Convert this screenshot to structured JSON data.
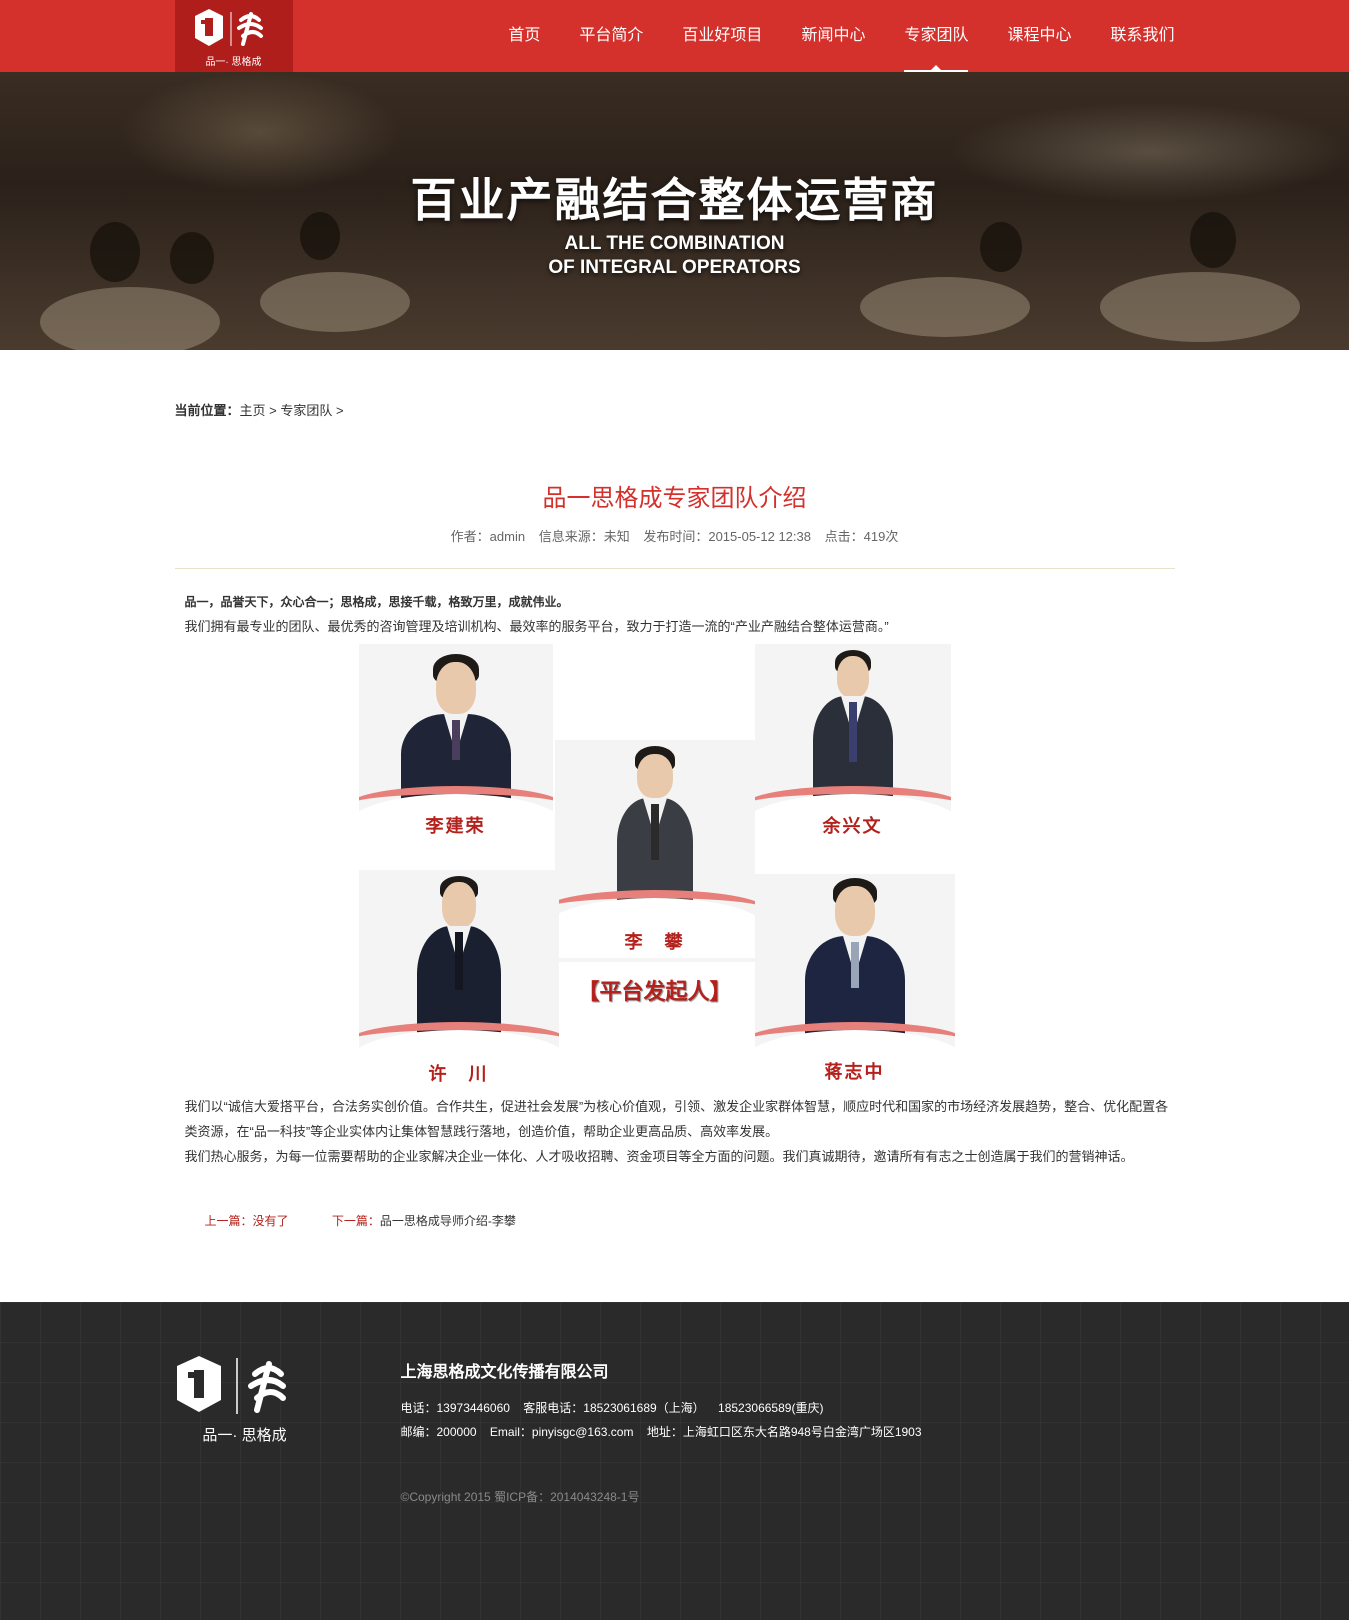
{
  "header": {
    "logo_sub": "品一· 思格成",
    "nav": [
      "首页",
      "平台简介",
      "百业好项目",
      "新闻中心",
      "专家团队",
      "课程中心",
      "联系我们"
    ],
    "active_index": 4
  },
  "banner": {
    "title": "百业产融结合整体运营商",
    "en_line1": "ALL THE COMBINATION",
    "en_line2": "OF INTEGRAL OPERATORS"
  },
  "breadcrumb": {
    "label": "当前位置：",
    "home": "主页",
    "sep1": " > ",
    "current": "专家团队",
    "sep2": " >"
  },
  "article": {
    "title": "品一思格成专家团队介绍",
    "author": "作者：admin",
    "source": "信息来源：未知",
    "date": "发布时间：2015-05-12 12:38",
    "hits": "点击：419次",
    "p1": "品一，品誉天下，众心合一；思格成，思接千载，格致万里，成就伟业。",
    "p2": "我们拥有最专业的团队、最优秀的咨询管理及培训机构、最效率的服务平台，致力于打造一流的“产业产融结合整体运营商。”",
    "p3": "我们以“诚信大爱搭平台，合法务实创价值。合作共生，促进社会发展”为核心价值观，引领、激发企业家群体智慧，顺应时代和国家的市场经济发展趋势，整合、优化配置各类资源，在“品一科技”等企业实体内让集体智慧践行落地，创造价值，帮助企业更高品质、高效率发展。",
    "p4": "我们热心服务，为每一位需要帮助的企业家解决企业一体化、人才吸收招聘、资金项目等全方面的问题。我们真诚期待，邀请所有有志之士创造属于我们的营销神话。",
    "team": {
      "names": [
        "李建荣",
        "余兴文",
        "李　攀",
        "许　川",
        "蒋志中"
      ],
      "founder": "【平台发起人】"
    },
    "prev": "上一篇：没有了",
    "next_label": "下一篇：",
    "next_link": "品一思格成导师介绍-李攀"
  },
  "footer": {
    "logo_sub": "品一· 思格成",
    "company": "上海思格成文化传播有限公司",
    "phone": "电话：13973446060",
    "service": "客服电话：18523061689（上海）",
    "service2": "18523066589(重庆)",
    "zip": "邮编：200000",
    "email": "Email：pinyisgc@163.com",
    "address": "地址：上海虹口区东大名路948号白金湾广场区1903",
    "copyright": "©Copyright 2015 蜀ICP备：2014043248-1号"
  },
  "colors": {
    "brand_red": "#d4302c",
    "name_red": "#b4211c",
    "footer_bg": "#2a2a2a"
  }
}
